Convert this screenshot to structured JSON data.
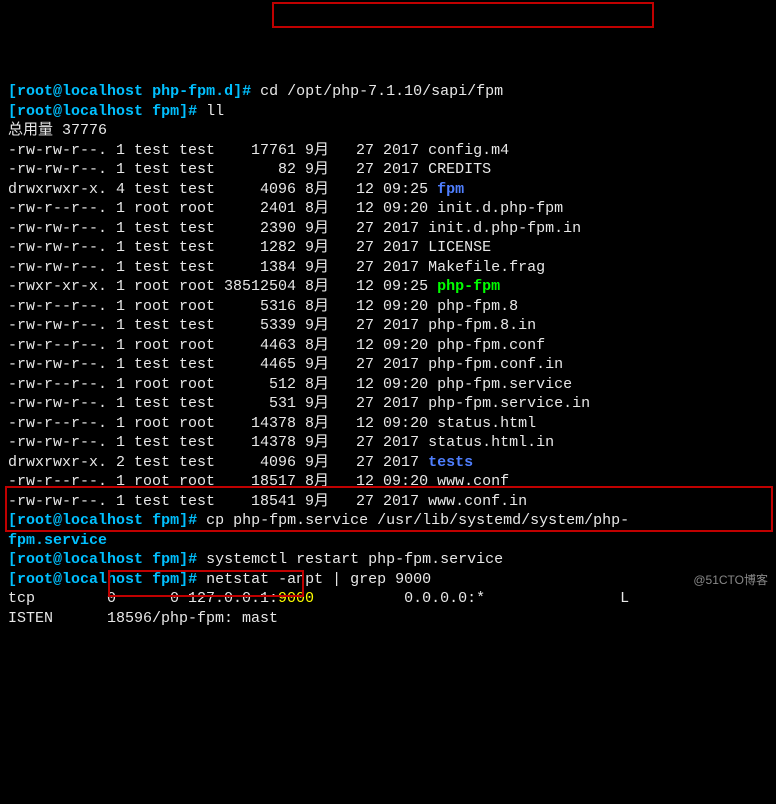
{
  "prompt1": {
    "open": "[",
    "user": "root@localhost",
    "space": " ",
    "dir": "php-fpm.d",
    "close": "]#",
    "cmd": " cd /opt/php-7.1.10/sapi/fpm"
  },
  "prompt2": {
    "open": "[",
    "user": "root@localhost",
    "space": " ",
    "dir": "fpm",
    "close": "]#",
    "cmd": " ll"
  },
  "total": "总用量 37776",
  "files": [
    {
      "perm": "-rw-rw-r--.",
      "n": "1",
      "owner": "test",
      "group": "test",
      "size": "    17761",
      "month": "9月",
      "day": "  27",
      "time": "2017",
      "name": "config.m4",
      "color": "grey"
    },
    {
      "perm": "-rw-rw-r--.",
      "n": "1",
      "owner": "test",
      "group": "test",
      "size": "       82",
      "month": "9月",
      "day": "  27",
      "time": "2017",
      "name": "CREDITS",
      "color": "grey"
    },
    {
      "perm": "drwxrwxr-x.",
      "n": "4",
      "owner": "test",
      "group": "test",
      "size": "     4096",
      "month": "8月",
      "day": "  12",
      "time": "09:25",
      "name": "fpm",
      "color": "blue"
    },
    {
      "perm": "-rw-r--r--.",
      "n": "1",
      "owner": "root",
      "group": "root",
      "size": "     2401",
      "month": "8月",
      "day": "  12",
      "time": "09:20",
      "name": "init.d.php-fpm",
      "color": "grey"
    },
    {
      "perm": "-rw-rw-r--.",
      "n": "1",
      "owner": "test",
      "group": "test",
      "size": "     2390",
      "month": "9月",
      "day": "  27",
      "time": "2017",
      "name": "init.d.php-fpm.in",
      "color": "grey"
    },
    {
      "perm": "-rw-rw-r--.",
      "n": "1",
      "owner": "test",
      "group": "test",
      "size": "     1282",
      "month": "9月",
      "day": "  27",
      "time": "2017",
      "name": "LICENSE",
      "color": "grey"
    },
    {
      "perm": "-rw-rw-r--.",
      "n": "1",
      "owner": "test",
      "group": "test",
      "size": "     1384",
      "month": "9月",
      "day": "  27",
      "time": "2017",
      "name": "Makefile.frag",
      "color": "grey"
    },
    {
      "perm": "-rwxr-xr-x.",
      "n": "1",
      "owner": "root",
      "group": "root",
      "size": " 38512504",
      "month": "8月",
      "day": "  12",
      "time": "09:25",
      "name": "php-fpm",
      "color": "green"
    },
    {
      "perm": "-rw-r--r--.",
      "n": "1",
      "owner": "root",
      "group": "root",
      "size": "     5316",
      "month": "8月",
      "day": "  12",
      "time": "09:20",
      "name": "php-fpm.8",
      "color": "grey"
    },
    {
      "perm": "-rw-rw-r--.",
      "n": "1",
      "owner": "test",
      "group": "test",
      "size": "     5339",
      "month": "9月",
      "day": "  27",
      "time": "2017",
      "name": "php-fpm.8.in",
      "color": "grey"
    },
    {
      "perm": "-rw-r--r--.",
      "n": "1",
      "owner": "root",
      "group": "root",
      "size": "     4463",
      "month": "8月",
      "day": "  12",
      "time": "09:20",
      "name": "php-fpm.conf",
      "color": "grey"
    },
    {
      "perm": "-rw-rw-r--.",
      "n": "1",
      "owner": "test",
      "group": "test",
      "size": "     4465",
      "month": "9月",
      "day": "  27",
      "time": "2017",
      "name": "php-fpm.conf.in",
      "color": "grey"
    },
    {
      "perm": "-rw-r--r--.",
      "n": "1",
      "owner": "root",
      "group": "root",
      "size": "      512",
      "month": "8月",
      "day": "  12",
      "time": "09:20",
      "name": "php-fpm.service",
      "color": "grey"
    },
    {
      "perm": "-rw-rw-r--.",
      "n": "1",
      "owner": "test",
      "group": "test",
      "size": "      531",
      "month": "9月",
      "day": "  27",
      "time": "2017",
      "name": "php-fpm.service.in",
      "color": "grey"
    },
    {
      "perm": "-rw-r--r--.",
      "n": "1",
      "owner": "root",
      "group": "root",
      "size": "    14378",
      "month": "8月",
      "day": "  12",
      "time": "09:20",
      "name": "status.html",
      "color": "grey"
    },
    {
      "perm": "-rw-rw-r--.",
      "n": "1",
      "owner": "test",
      "group": "test",
      "size": "    14378",
      "month": "9月",
      "day": "  27",
      "time": "2017",
      "name": "status.html.in",
      "color": "grey"
    },
    {
      "perm": "drwxrwxr-x.",
      "n": "2",
      "owner": "test",
      "group": "test",
      "size": "     4096",
      "month": "9月",
      "day": "  27",
      "time": "2017",
      "name": "tests",
      "color": "blue"
    },
    {
      "perm": "-rw-r--r--.",
      "n": "1",
      "owner": "root",
      "group": "root",
      "size": "    18517",
      "month": "8月",
      "day": "  12",
      "time": "09:20",
      "name": "www.conf",
      "color": "grey"
    },
    {
      "perm": "-rw-rw-r--.",
      "n": "1",
      "owner": "test",
      "group": "test",
      "size": "    18541",
      "month": "9月",
      "day": "  27",
      "time": "2017",
      "name": "www.conf.in",
      "color": "grey"
    }
  ],
  "prompt3": {
    "open": "[",
    "user": "root@localhost",
    "space": " ",
    "dir": "fpm",
    "close": "]#",
    "cmd": " cp php-fpm.service /usr/lib/systemd/system/php-"
  },
  "cont3": "fpm.service",
  "prompt4": {
    "open": "[",
    "user": "root@localhost",
    "space": " ",
    "dir": "fpm",
    "close": "]#",
    "cmd": " systemctl restart php-fpm.service"
  },
  "prompt5": {
    "open": "[",
    "user": "root@localhost",
    "space": " ",
    "dir": "fpm",
    "close": "]#",
    "cmd": " netstat -anpt | grep 9000"
  },
  "net1a": "tcp        0      0 127.0.0.1:",
  "net1port": "9000",
  "net1b": "          0.0.0.0:*               L",
  "net2": "ISTEN      18596/php-fpm: mast ",
  "watermark": "@51CTO博客"
}
